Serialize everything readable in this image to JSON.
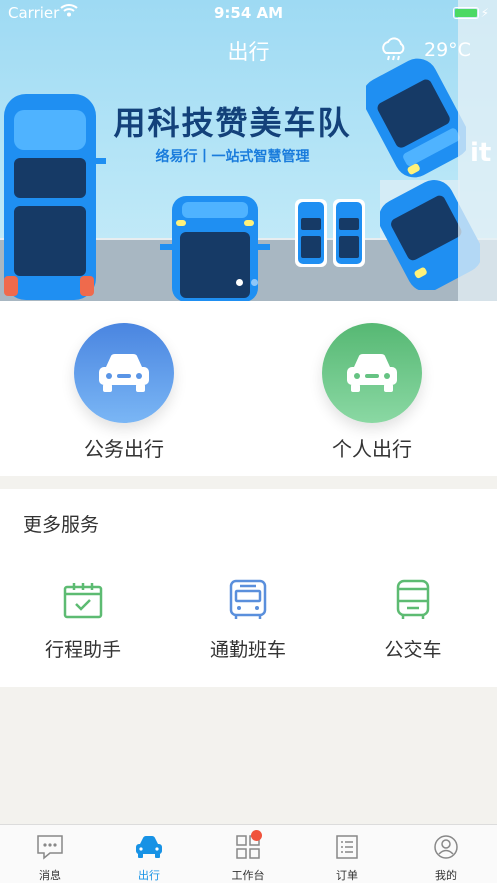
{
  "status_bar": {
    "carrier": "Carrier",
    "time": "9:54 AM"
  },
  "nav": {
    "title": "出行",
    "temperature": "29°C",
    "weather_icon": "cloud-rain-icon"
  },
  "banner": {
    "headline": "用科技赞美车队",
    "subline": "络易行丨一站式智慧管理",
    "side_text": "it",
    "page_count": 2,
    "active_page": 1
  },
  "travel": [
    {
      "label": "公务出行",
      "icon": "car-icon",
      "color": "#4a85e0"
    },
    {
      "label": "个人出行",
      "icon": "car-icon",
      "color": "#56b873"
    }
  ],
  "services": {
    "title": "更多服务",
    "items": [
      {
        "label": "行程助手",
        "icon": "calendar-check-icon",
        "color": "#5dbb72"
      },
      {
        "label": "通勤班车",
        "icon": "shuttle-bus-icon",
        "color": "#5a8fdc"
      },
      {
        "label": "公交车",
        "icon": "bus-icon",
        "color": "#5dbb72"
      }
    ]
  },
  "tabbar": {
    "active": "出行",
    "tabs": [
      {
        "label": "消息",
        "icon": "message-icon"
      },
      {
        "label": "出行",
        "icon": "car-icon"
      },
      {
        "label": "工作台",
        "icon": "grid-icon",
        "badge": true
      },
      {
        "label": "订单",
        "icon": "order-list-icon"
      },
      {
        "label": "我的",
        "icon": "user-icon"
      }
    ]
  },
  "colors": {
    "accent": "#1792e5",
    "badge": "#f0533c",
    "banner_sky": "#9edaf3"
  }
}
